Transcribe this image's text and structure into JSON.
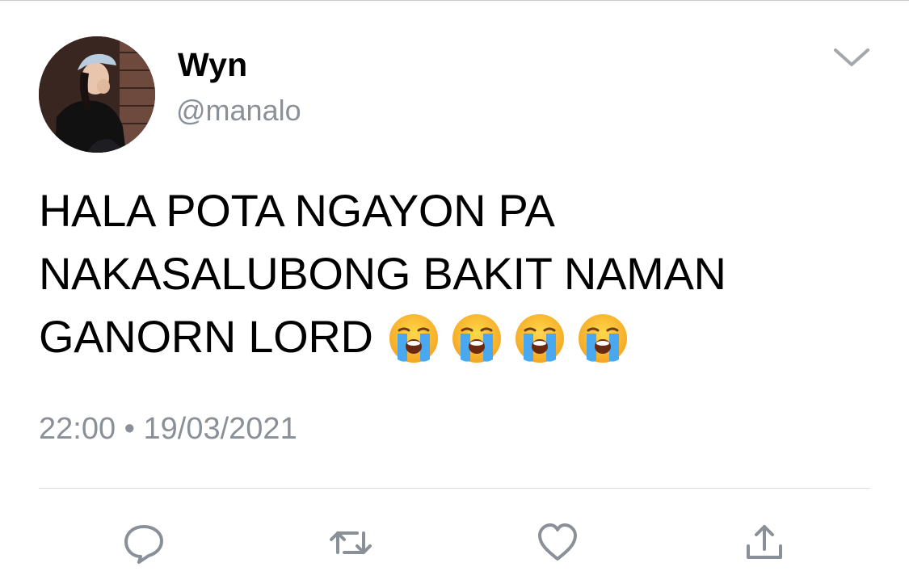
{
  "tweet": {
    "author": {
      "display_name": "Wyn",
      "handle": "@manalo",
      "avatar_icon": "profile-photo"
    },
    "text_lines": [
      "HALA POTA NGAYON PA",
      "NAKASALUBONG BAKIT NAMAN",
      "GANORN LORD"
    ],
    "emojis": [
      "loudly-crying-face",
      "loudly-crying-face",
      "loudly-crying-face",
      "loudly-crying-face"
    ],
    "timestamp": "22:00 • 19/03/2021",
    "menu_icon": "chevron-down-icon"
  },
  "actions": [
    {
      "name": "reply",
      "icon": "reply-icon"
    },
    {
      "name": "retweet",
      "icon": "retweet-icon"
    },
    {
      "name": "like",
      "icon": "heart-icon"
    },
    {
      "name": "share",
      "icon": "share-icon"
    }
  ],
  "colors": {
    "secondary_text": "#8a9097",
    "icon_gray": "#8a9097",
    "divider": "#d9dde1"
  }
}
